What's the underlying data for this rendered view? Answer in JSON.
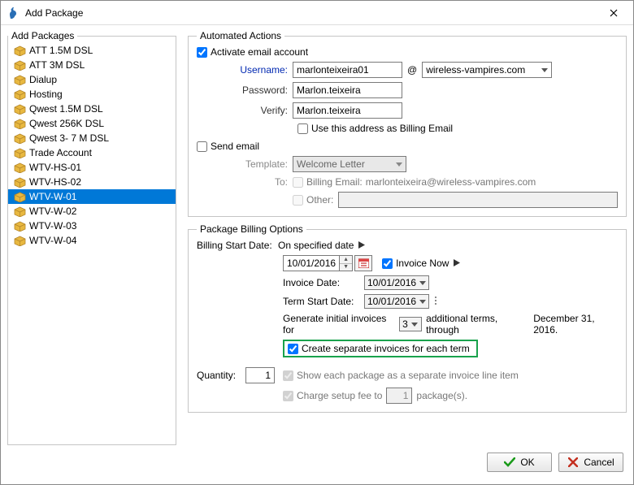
{
  "window": {
    "title": "Add Package"
  },
  "left": {
    "legend": "Add Packages",
    "items": [
      {
        "label": "ATT 1.5M DSL"
      },
      {
        "label": "ATT 3M DSL"
      },
      {
        "label": "Dialup"
      },
      {
        "label": "Hosting"
      },
      {
        "label": "Qwest 1.5M DSL"
      },
      {
        "label": "Qwest 256K DSL"
      },
      {
        "label": "Qwest 3- 7 M DSL"
      },
      {
        "label": "Trade Account"
      },
      {
        "label": "WTV-HS-01"
      },
      {
        "label": "WTV-HS-02"
      },
      {
        "label": "WTV-W-01",
        "selected": true
      },
      {
        "label": "WTV-W-02"
      },
      {
        "label": "WTV-W-03"
      },
      {
        "label": "WTV-W-04"
      }
    ]
  },
  "auto": {
    "legend": "Automated Actions",
    "activate_label": "Activate email account",
    "activate_checked": true,
    "username_label": "Username:",
    "username_value": "marlonteixeira01",
    "at": "@",
    "domain_value": "wireless-vampires.com",
    "password_label": "Password:",
    "password_value": "Marlon.teixeira",
    "verify_label": "Verify:",
    "verify_value": "Marlon.teixeira",
    "use_billing_label": "Use this address as Billing Email",
    "use_billing_checked": false,
    "send_email_label": "Send email",
    "send_email_checked": false,
    "template_label": "Template:",
    "template_value": "Welcome Letter",
    "to_label": "To:",
    "billing_email_label": "Billing Email:",
    "billing_email_value": "marlonteixeira@wireless-vampires.com",
    "other_label": "Other:"
  },
  "billing": {
    "legend": "Package Billing Options",
    "start_label": "Billing Start Date:",
    "start_mode": "On specified date",
    "start_date": "10/01/2016",
    "invoice_now_label": "Invoice Now",
    "invoice_now_checked": true,
    "invoice_date_label": "Invoice Date:",
    "invoice_date_value": "10/01/2016",
    "term_start_label": "Term Start Date:",
    "term_start_value": "10/01/2016",
    "gen_prefix": "Generate initial invoices for",
    "gen_count": "3",
    "gen_suffix": "additional terms, through",
    "gen_through": "December 31, 2016.",
    "separate_label": "Create separate invoices for each term",
    "separate_checked": true,
    "quantity_label": "Quantity:",
    "quantity_value": "1",
    "show_each_label": "Show each package as a separate invoice line item",
    "show_each_checked": true,
    "charge_setup_label_prefix": "Charge setup fee to",
    "charge_setup_value": "1",
    "charge_setup_label_suffix": "package(s).",
    "charge_setup_checked": true
  },
  "footer": {
    "ok": "OK",
    "cancel": "Cancel"
  }
}
